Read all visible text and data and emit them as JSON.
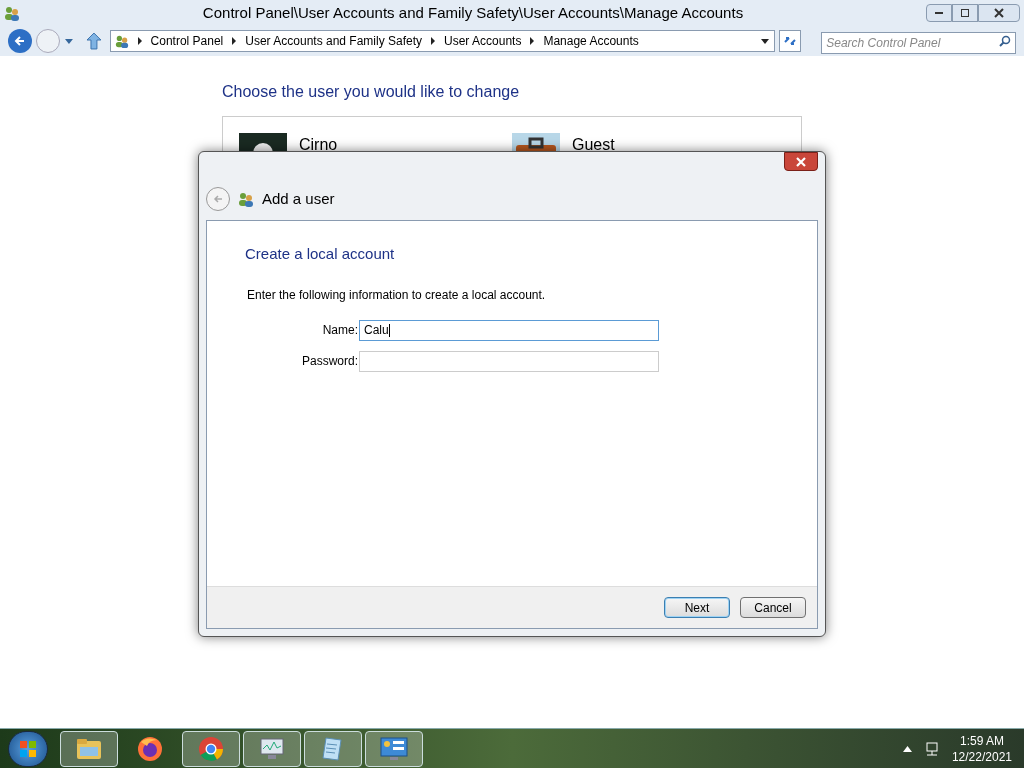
{
  "window": {
    "title": "Control Panel\\User Accounts and Family Safety\\User Accounts\\Manage Accounts"
  },
  "address_bar": {
    "crumbs": [
      "Control Panel",
      "User Accounts and Family Safety",
      "User Accounts",
      "Manage Accounts"
    ]
  },
  "search": {
    "placeholder": "Search Control Panel"
  },
  "content": {
    "heading": "Choose the user you would like to change",
    "accounts": [
      {
        "name": "Cirno",
        "kind": "person"
      },
      {
        "name": "Guest",
        "kind": "briefcase"
      }
    ]
  },
  "dialog": {
    "title": "Add a user",
    "heading": "Create a local account",
    "instruction": "Enter the following information to create a local account.",
    "fields": [
      {
        "label": "Name:",
        "value": "Calu",
        "focused": true
      },
      {
        "label": "Password:",
        "focused": false
      }
    ],
    "buttons": [
      {
        "label": "Next",
        "default": true
      },
      {
        "label": "Cancel",
        "default": false
      }
    ]
  },
  "taskbar": {
    "apps": [
      {
        "kind": "folder",
        "running": true
      },
      {
        "kind": "firefox",
        "running": false
      },
      {
        "kind": "chrome",
        "running": true
      },
      {
        "kind": "monitor",
        "running": true
      },
      {
        "kind": "notepad",
        "running": true
      },
      {
        "kind": "panel",
        "running": true
      }
    ],
    "time": "1:59 AM",
    "date": "12/22/2021"
  }
}
